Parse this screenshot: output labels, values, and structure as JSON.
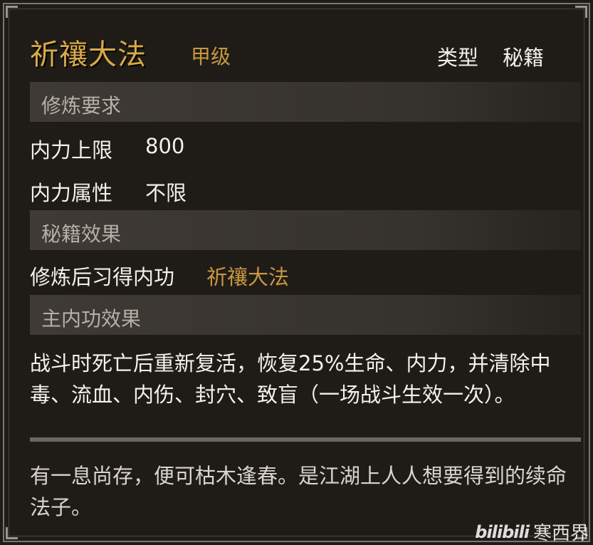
{
  "header": {
    "title": "祈禳大法",
    "grade": "甲级",
    "type_label": "类型",
    "type_value": "秘籍"
  },
  "requirements": {
    "section_title": "修炼要求",
    "rows": [
      {
        "label": "内力上限",
        "value": "800"
      },
      {
        "label": "内力属性",
        "value": "不限"
      }
    ]
  },
  "book_effect": {
    "section_title": "秘籍效果",
    "label": "修炼后习得内功",
    "value": "祈禳大法"
  },
  "main_effect": {
    "section_title": "主内功效果",
    "text": "战斗时死亡后重新复活，恢复25%生命、内力，并清除中毒、流血、内伤、封穴、致盲（一场战斗生效一次）。"
  },
  "flavor": {
    "text": "有一息尚存，便可枯木逢春。是江湖上人人想要得到的续命法子。"
  },
  "watermark": {
    "logo": "bilibili",
    "author": "寒西界"
  },
  "colors": {
    "accent_gold": "#d9a94a",
    "text_white": "#f2f0ea",
    "section_bg": "#3f3a36",
    "panel_bg": "#1f1c18"
  }
}
